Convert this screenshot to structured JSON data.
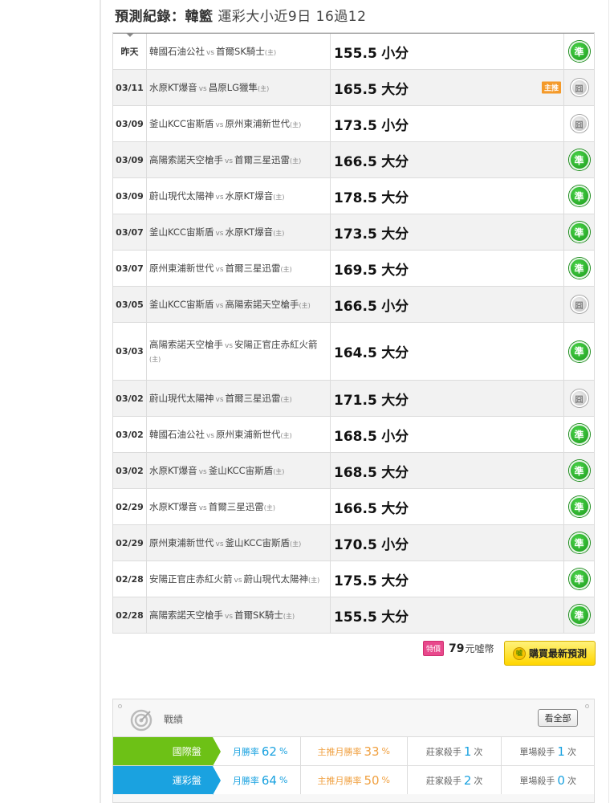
{
  "header": {
    "title_bold": "預測紀錄：韓籃",
    "title_rest": "運彩大小近9日 16過12"
  },
  "records": [
    {
      "date": "昨天",
      "away": "韓國石油公社",
      "vs": "vs",
      "home": "首爾SK騎士",
      "host": "(主)",
      "line": "155.5",
      "pick": "小分",
      "main": "",
      "result": "準"
    },
    {
      "date": "03/11",
      "away": "水原KT爆音",
      "vs": "vs",
      "home": "昌原LG獵隼",
      "host": "(主)",
      "line": "165.5",
      "pick": "大分",
      "main": "主推",
      "result": "囧"
    },
    {
      "date": "03/09",
      "away": "釜山KCC宙斯盾",
      "vs": "vs",
      "home": "原州東浦新世代",
      "host": "(主)",
      "line": "173.5",
      "pick": "小分",
      "main": "",
      "result": "囧"
    },
    {
      "date": "03/09",
      "away": "高陽索諾天空槍手",
      "vs": "vs",
      "home": "首爾三星迅雷",
      "host": "(主)",
      "line": "166.5",
      "pick": "大分",
      "main": "",
      "result": "準"
    },
    {
      "date": "03/09",
      "away": "蔚山現代太陽神",
      "vs": "vs",
      "home": "水原KT爆音",
      "host": "(主)",
      "line": "178.5",
      "pick": "大分",
      "main": "",
      "result": "準"
    },
    {
      "date": "03/07",
      "away": "釜山KCC宙斯盾",
      "vs": "vs",
      "home": "水原KT爆音",
      "host": "(主)",
      "line": "173.5",
      "pick": "大分",
      "main": "",
      "result": "準"
    },
    {
      "date": "03/07",
      "away": "原州東浦新世代",
      "vs": "vs",
      "home": "首爾三星迅雷",
      "host": "(主)",
      "line": "169.5",
      "pick": "大分",
      "main": "",
      "result": "準"
    },
    {
      "date": "03/05",
      "away": "釜山KCC宙斯盾",
      "vs": "vs",
      "home": "高陽索諾天空槍手",
      "host": "(主)",
      "line": "166.5",
      "pick": "小分",
      "main": "",
      "result": "囧"
    },
    {
      "date": "03/03",
      "away": "高陽索諾天空槍手",
      "vs": "vs",
      "home": "安陽正官庄赤紅火箭",
      "host": "(主)",
      "line": "164.5",
      "pick": "大分",
      "main": "",
      "result": "準"
    },
    {
      "date": "03/02",
      "away": "蔚山現代太陽神",
      "vs": "vs",
      "home": "首爾三星迅雷",
      "host": "(主)",
      "line": "171.5",
      "pick": "大分",
      "main": "",
      "result": "囧"
    },
    {
      "date": "03/02",
      "away": "韓國石油公社",
      "vs": "vs",
      "home": "原州東浦新世代",
      "host": "(主)",
      "line": "168.5",
      "pick": "小分",
      "main": "",
      "result": "準"
    },
    {
      "date": "03/02",
      "away": "水原KT爆音",
      "vs": "vs",
      "home": "釜山KCC宙斯盾",
      "host": "(主)",
      "line": "168.5",
      "pick": "大分",
      "main": "",
      "result": "準"
    },
    {
      "date": "02/29",
      "away": "水原KT爆音",
      "vs": "vs",
      "home": "首爾三星迅雷",
      "host": "(主)",
      "line": "166.5",
      "pick": "大分",
      "main": "",
      "result": "準"
    },
    {
      "date": "02/29",
      "away": "原州東浦新世代",
      "vs": "vs",
      "home": "釜山KCC宙斯盾",
      "host": "(主)",
      "line": "170.5",
      "pick": "小分",
      "main": "",
      "result": "準"
    },
    {
      "date": "02/28",
      "away": "安陽正官庄赤紅火箭",
      "vs": "vs",
      "home": "蔚山現代太陽神",
      "host": "(主)",
      "line": "175.5",
      "pick": "大分",
      "main": "",
      "result": "準"
    },
    {
      "date": "02/28",
      "away": "高陽索諾天空槍手",
      "vs": "vs",
      "home": "首爾SK騎士",
      "host": "(主)",
      "line": "155.5",
      "pick": "大分",
      "main": "",
      "result": "準"
    }
  ],
  "purchase": {
    "special_tag": "特價",
    "price": "79",
    "unit": "元噓幣",
    "buy_label": "購買最新預測",
    "colors": {
      "button": "#ffd600",
      "tag": "#e8488c"
    }
  },
  "stats": {
    "title": "戰績",
    "see_all": "看全部",
    "rows": [
      {
        "label": "國際盤",
        "color": "#6dc116",
        "month_rate_label": "月勝率",
        "month_rate": "62",
        "pct": "%",
        "main_rate_label": "主推月勝率",
        "main_rate": "33",
        "main_pct": "%",
        "dealer_label": "莊家殺手",
        "dealer": "1",
        "dealer_unit": "次",
        "single_label": "單場殺手",
        "single": "1",
        "single_unit": "次"
      },
      {
        "label": "運彩盤",
        "color": "#1aa2e0",
        "month_rate_label": "月勝率",
        "month_rate": "64",
        "pct": "%",
        "main_rate_label": "主推月勝率",
        "main_rate": "50",
        "main_pct": "%",
        "dealer_label": "莊家殺手",
        "dealer": "2",
        "dealer_unit": "次",
        "single_label": "單場殺手",
        "single": "0",
        "single_unit": "次"
      }
    ]
  }
}
